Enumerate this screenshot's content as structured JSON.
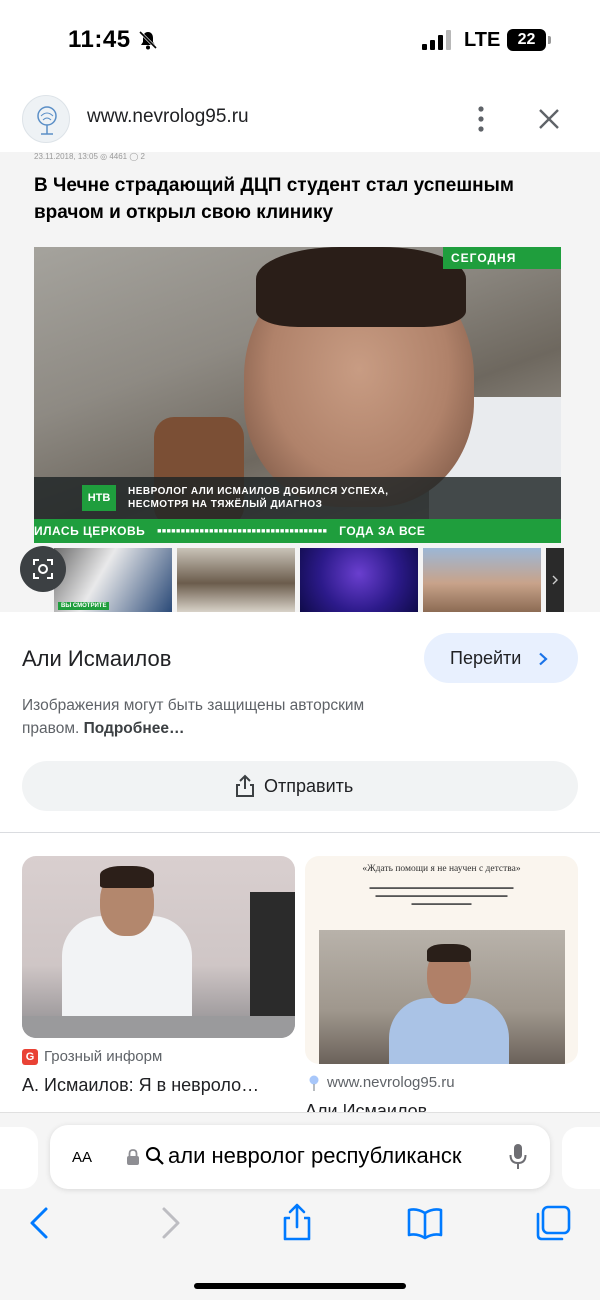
{
  "status_bar": {
    "time": "11:45",
    "network": "LTE",
    "battery": "22",
    "icons": [
      "bell-off-icon",
      "signal-icon",
      "battery-icon"
    ]
  },
  "source": {
    "url": "www.nevrolog95.ru",
    "icons": [
      "site-favicon",
      "more-vert-icon",
      "close-icon"
    ]
  },
  "article": {
    "meta": "23.11.2018, 13:05   ◎ 4461  ◯ 2",
    "title": "В Чечне страдающий ДЦП студент стал успешным врачом и открыл свою клинику",
    "tv_badge": "СЕГОДНЯ",
    "tv_logo": "НТВ",
    "tv_caption": "НЕВРОЛОГ АЛИ ИСМАИЛОВ ДОБИЛСЯ УСПЕХА, НЕСМОТРЯ НА ТЯЖЁЛЫЙ ДИАГНОЗ",
    "tv_ticker_left": "ИЛАСЬ ЦЕРКОВЬ",
    "tv_ticker_right": "ГОДА   ЗА ВСЕ",
    "thumb_tag": "ВЫ СМОТРИТЕ"
  },
  "result": {
    "title": "Али Исмаилов",
    "go_label": "Перейти",
    "copyright_text": "Изображения могут быть защищены авторским правом.",
    "copyright_more": "Подробнее…",
    "share_label": "Отправить"
  },
  "related": [
    {
      "source": "Грозный информ",
      "source_icon_letter": "G",
      "title": "А. Исмаилов: Я в невроло…"
    },
    {
      "source": "www.nevrolog95.ru",
      "title": "Али Исмаилов",
      "paper_heading": "«Ждать помощи я не научен с детства»"
    }
  ],
  "browser": {
    "aa_label": "AA",
    "address": "али невролог республиканск",
    "icons": [
      "lock-icon",
      "search-icon",
      "mic-icon",
      "back-icon",
      "forward-icon",
      "share-icon",
      "bookmarks-icon",
      "tabs-icon"
    ]
  },
  "colors": {
    "ntv_green": "#1f9e3d",
    "go_button_bg": "#e8f0fe",
    "safari_tint": "#007aff"
  }
}
